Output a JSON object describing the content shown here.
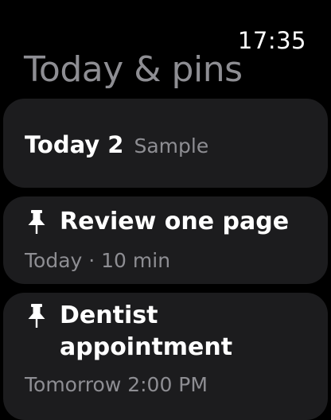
{
  "status": {
    "time": "17:35"
  },
  "header": {
    "title": "Today & pins"
  },
  "today": {
    "label": "Today 2",
    "sample": "Sample"
  },
  "tasks": [
    {
      "icon": "pin-icon",
      "title": "Review one page",
      "subtitle": "Today · 10 min"
    },
    {
      "icon": "pin-icon",
      "title": "Dentist appointment",
      "subtitle": "Tomorrow 2:00 PM"
    }
  ]
}
